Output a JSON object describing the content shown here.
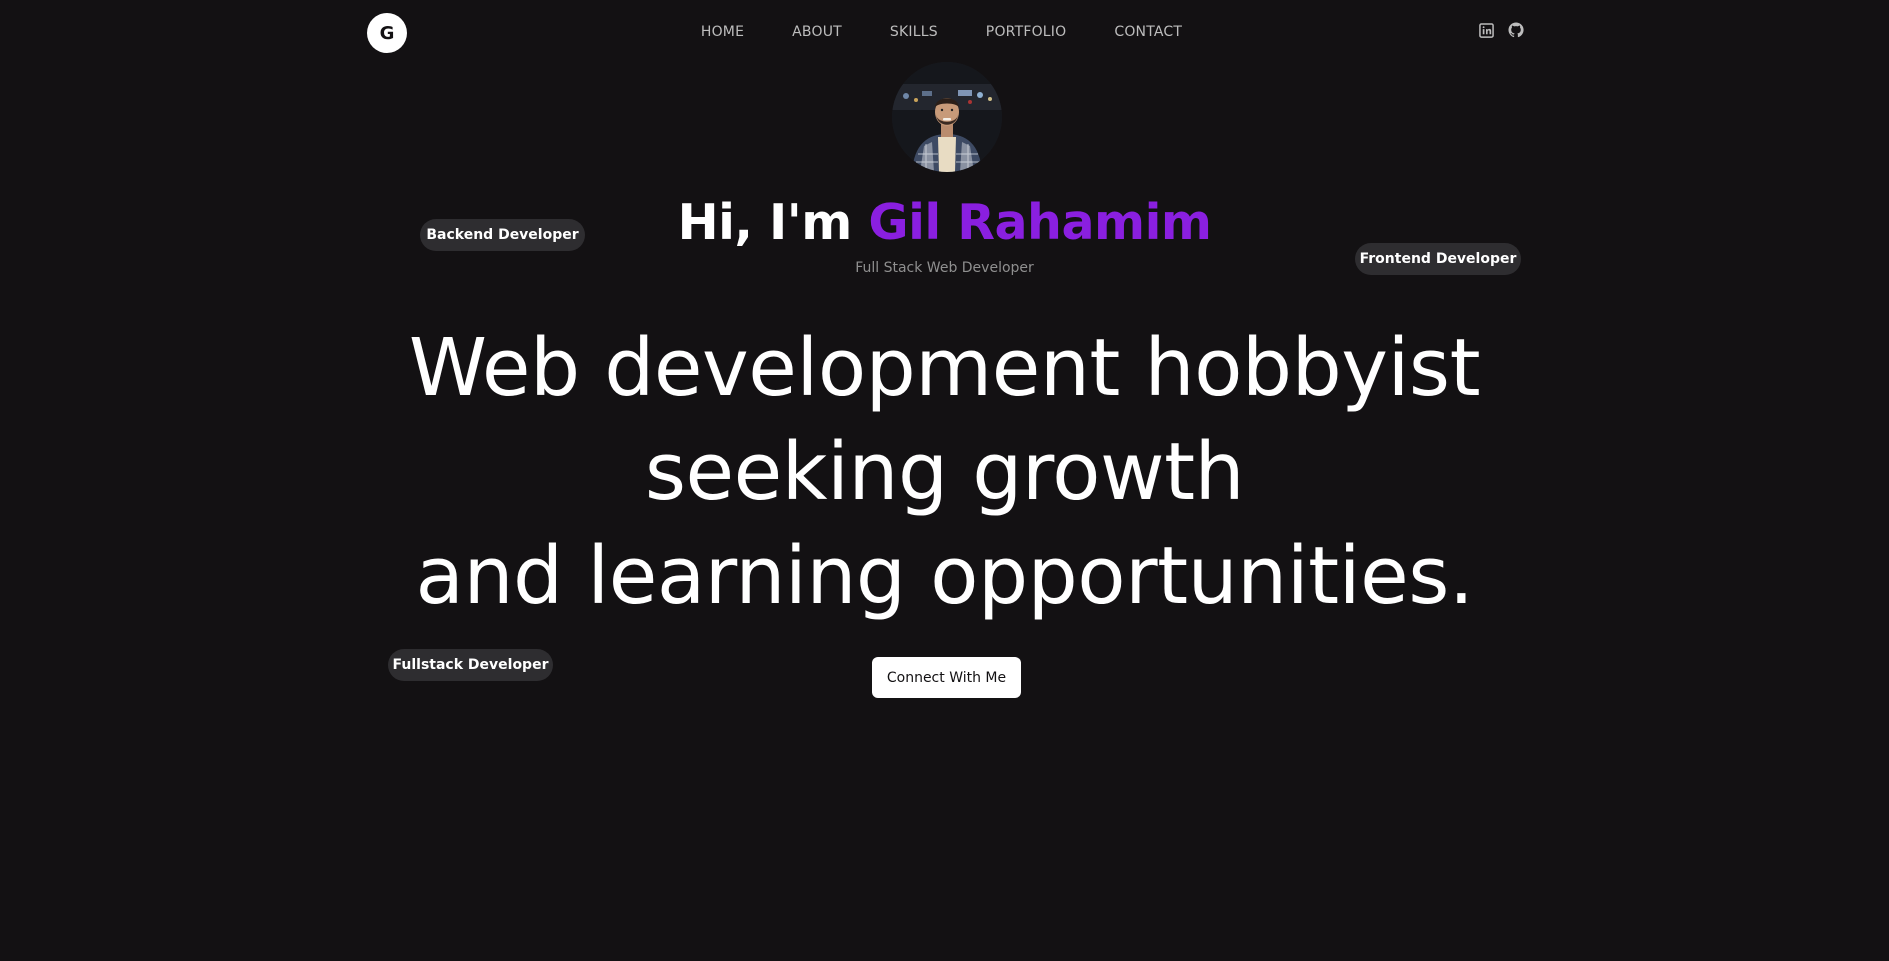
{
  "header": {
    "logo_letter": "G",
    "nav": [
      {
        "label": "HOME"
      },
      {
        "label": "ABOUT"
      },
      {
        "label": "SKILLS"
      },
      {
        "label": "PORTFOLIO"
      },
      {
        "label": "CONTACT"
      }
    ],
    "social": [
      {
        "icon": "linkedin-icon"
      },
      {
        "icon": "github-icon"
      }
    ]
  },
  "hero": {
    "greeting_prefix": "Hi, I'm ",
    "name": "Gil Rahamim",
    "subtitle": "Full Stack Web Developer",
    "headline_lines": [
      "Web development hobbyist",
      "seeking growth",
      "and learning opportunities."
    ],
    "cta_label": "Connect With Me"
  },
  "badges": {
    "backend": "Backend Developer",
    "frontend": "Frontend Developer",
    "fullstack": "Fullstack Developer"
  },
  "colors": {
    "background": "#131113",
    "accent": "#8a1fe0",
    "badge_bg": "#2e2d30"
  }
}
